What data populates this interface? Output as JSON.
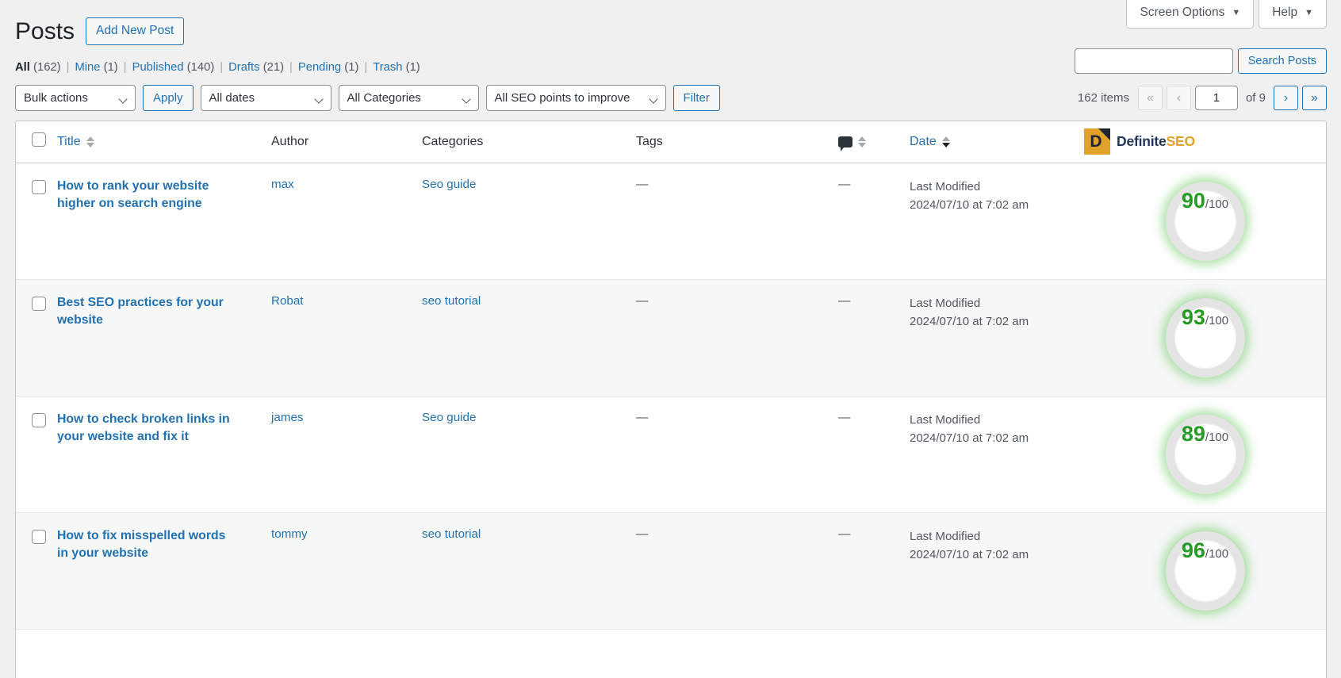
{
  "top_tabs": [
    {
      "label": "Screen Options",
      "icon": "chevron-down-icon"
    },
    {
      "label": "Help",
      "icon": "chevron-down-icon"
    }
  ],
  "header": {
    "title": "Posts",
    "add_new_label": "Add New Post"
  },
  "status_links": [
    {
      "label": "All",
      "count": "(162)",
      "current": true
    },
    {
      "label": "Mine",
      "count": "(1)",
      "current": false
    },
    {
      "label": "Published",
      "count": "(140)",
      "current": false
    },
    {
      "label": "Drafts",
      "count": "(21)",
      "current": false
    },
    {
      "label": "Pending",
      "count": "(1)",
      "current": false
    },
    {
      "label": "Trash",
      "count": "(1)",
      "current": false
    }
  ],
  "search": {
    "value": "",
    "placeholder": "",
    "submit_label": "Search Posts"
  },
  "toolbar": {
    "bulk_actions": "Bulk actions",
    "apply_label": "Apply",
    "all_dates": "All dates",
    "all_categories": "All Categories",
    "seo_filter": "All SEO points to improve",
    "filter_label": "Filter"
  },
  "pagination": {
    "items_label": "162 items",
    "first_label": "«",
    "prev_label": "‹",
    "current_page": "1",
    "of_label": "of 9",
    "next_label": "›",
    "last_label": "»"
  },
  "table": {
    "columns": {
      "title": "Title",
      "author": "Author",
      "categories": "Categories",
      "tags": "Tags",
      "comments": "comment-icon",
      "date": "Date"
    },
    "logo": {
      "mark_letter": "D",
      "name_part1": "Definite",
      "name_part2": "SEO",
      "mark_color": "#e2a22a",
      "text_color": "#1f3557"
    },
    "rows": [
      {
        "title": "How to rank your website higher on search engine",
        "author": "max",
        "categories": "Seo guide",
        "tags": "—",
        "comments": "—",
        "date_label": "Last Modified",
        "date_value": "2024/07/10 at 7:02 am",
        "score": "90",
        "score_total": "/100"
      },
      {
        "title": "Best SEO practices for your website",
        "author": "Robat",
        "categories": "seo tutorial",
        "tags": "—",
        "comments": "—",
        "date_label": "Last Modified",
        "date_value": "2024/07/10 at 7:02 am",
        "score": "93",
        "score_total": "/100"
      },
      {
        "title": "How to check broken links in your website and fix it",
        "author": "james",
        "categories": "Seo guide",
        "tags": "—",
        "comments": "—",
        "date_label": "Last Modified",
        "date_value": "2024/07/10 at 7:02 am",
        "score": "89",
        "score_total": "/100"
      },
      {
        "title": "How to fix misspelled words in your website",
        "author": "tommy",
        "categories": "seo tutorial",
        "tags": "—",
        "comments": "—",
        "date_label": "Last Modified",
        "date_value": "2024/07/10 at 7:02 am",
        "score": "96",
        "score_total": "/100"
      }
    ]
  },
  "colors": {
    "score_green": "#259b24",
    "link_blue": "#2271b1",
    "brand_gold": "#e2a22a"
  }
}
